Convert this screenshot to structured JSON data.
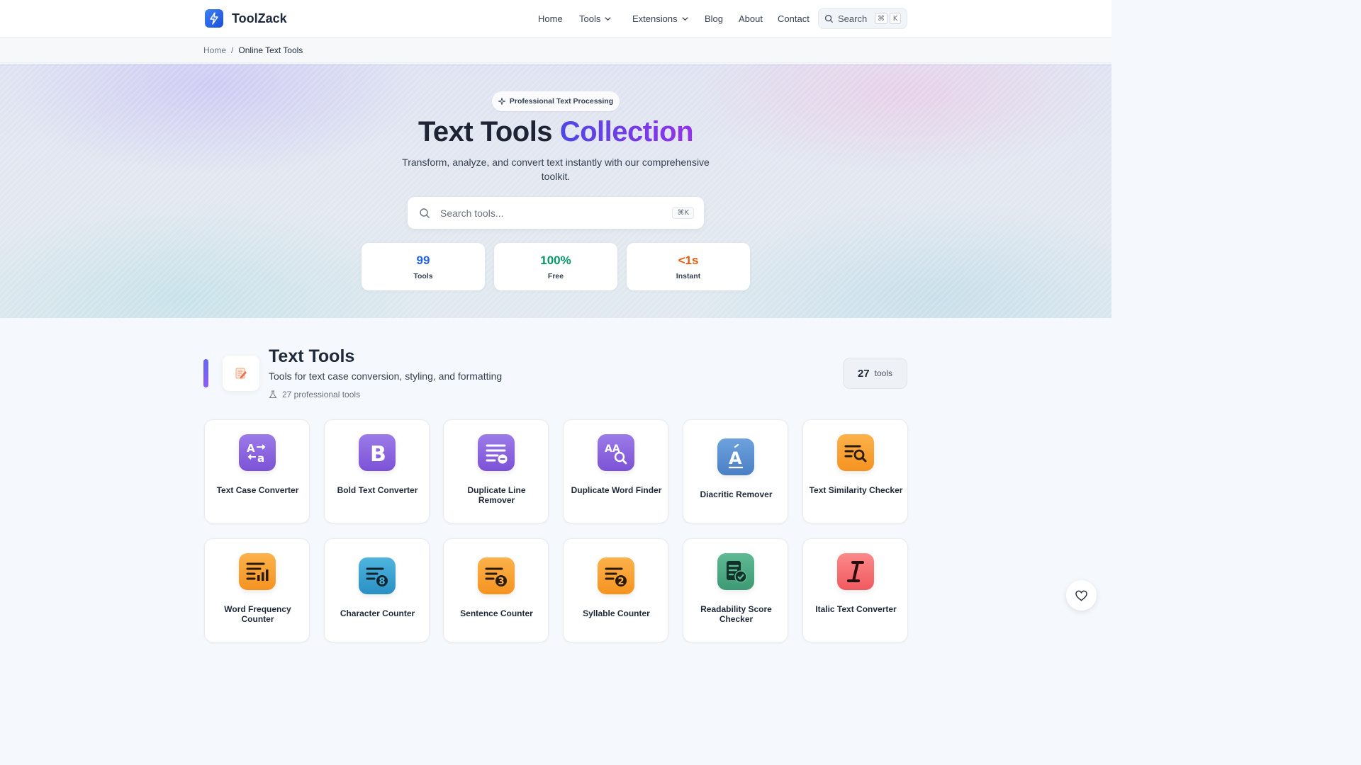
{
  "header": {
    "brand": "ToolZack",
    "nav": {
      "home": "Home",
      "tools": "Tools",
      "extensions": "Extensions",
      "blog": "Blog",
      "about": "About",
      "contact": "Contact"
    },
    "search_label": "Search",
    "shortcut_cmd": "⌘",
    "shortcut_key": "K"
  },
  "breadcrumb": {
    "home": "Home",
    "separator": "/",
    "current": "Online Text Tools"
  },
  "hero": {
    "badge": "Professional Text Processing",
    "title_main": "Text Tools",
    "title_accent": "Collection",
    "subtitle": "Transform, analyze, and convert text instantly with our comprehensive toolkit.",
    "search_placeholder": "Search tools...",
    "search_shortcut": "⌘K",
    "stats": [
      {
        "value": "99",
        "label": "Tools",
        "color": "#2563eb"
      },
      {
        "value": "100%",
        "label": "Free",
        "color": "#059669"
      },
      {
        "value": "<1s",
        "label": "Instant",
        "color": "#ea580c"
      }
    ]
  },
  "section": {
    "title": "Text Tools",
    "description": "Tools for text case conversion, styling, and formatting",
    "meta": "27 professional tools",
    "count": "27",
    "count_label": "tools"
  },
  "tools": [
    {
      "name": "Text Case Converter",
      "icon": "text-case-icon"
    },
    {
      "name": "Bold Text Converter",
      "icon": "bold-b-icon"
    },
    {
      "name": "Duplicate Line Remover",
      "icon": "lines-minus-icon"
    },
    {
      "name": "Duplicate Word Finder",
      "icon": "aa-search-icon"
    },
    {
      "name": "Diacritic Remover",
      "icon": "accent-a-icon"
    },
    {
      "name": "Text Similarity Checker",
      "icon": "text-search-icon"
    },
    {
      "name": "Word Frequency Counter",
      "icon": "lines-bar-chart-icon"
    },
    {
      "name": "Character Counter",
      "icon": "lines-8-icon"
    },
    {
      "name": "Sentence Counter",
      "icon": "lines-3-icon"
    },
    {
      "name": "Syllable Counter",
      "icon": "lines-2-icon"
    },
    {
      "name": "Readability Score Checker",
      "icon": "doc-check-icon"
    },
    {
      "name": "Italic Text Converter",
      "icon": "italic-i-icon"
    }
  ],
  "colors": {
    "brand": "#2563eb",
    "purple_icon": "#8b5cf6",
    "orange_icon": "#f59e0b",
    "blue_icon": "#3b82f6",
    "green_icon": "#059669",
    "red_icon": "#f87171"
  }
}
